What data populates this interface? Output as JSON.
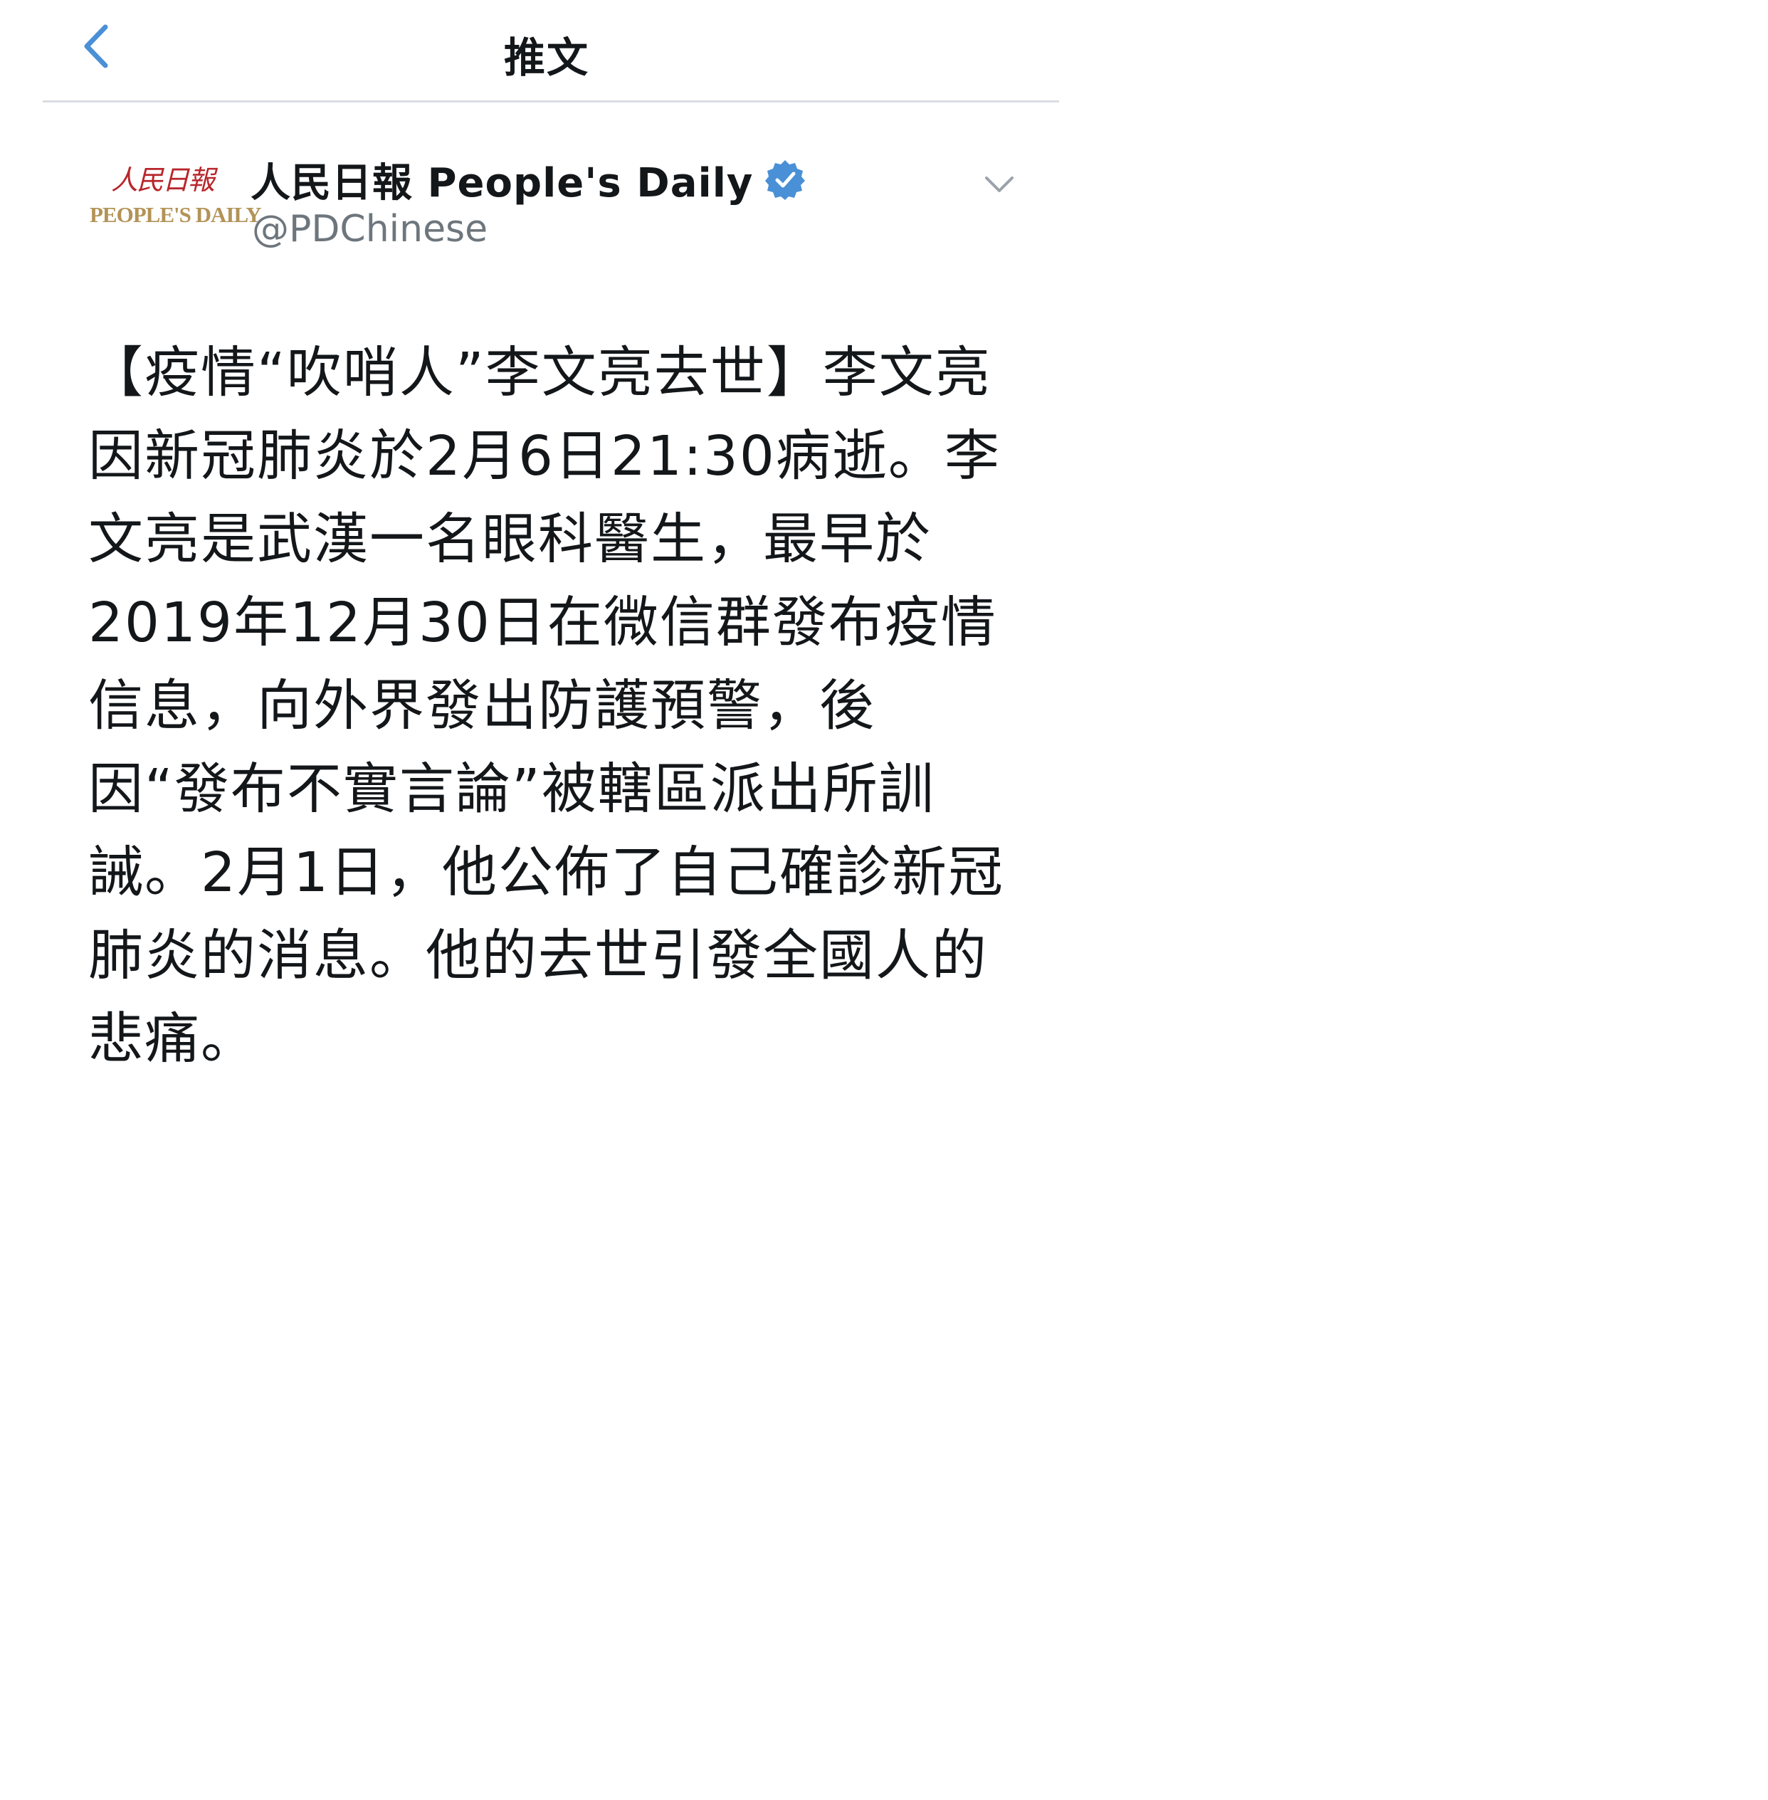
{
  "header": {
    "title": "推文",
    "back_icon": "chevron-left-icon"
  },
  "author": {
    "avatar_text_cn": "人民日報",
    "avatar_text_en": "PEOPLE'S DAILY",
    "display_name": "人民日報  People's Daily",
    "handle": "@PDChinese",
    "verified": true,
    "verified_icon": "verified-badge-icon",
    "menu_icon": "chevron-down-icon"
  },
  "tweet": {
    "text": "【疫情“吹哨人”李文亮去世】李文亮因新冠肺炎於2月6日21:30病逝。李文亮是武漢一名眼科醫生，最早於2019年12月30日在微信群發布疫情信息，向外界發出防護預警，後因“發布不實言論”被轄區派出所訓誡。2月1日，他公佈了自己確診新冠肺炎的消息。他的去世引發全國人的悲痛。"
  },
  "colors": {
    "accent": "#4a90d6",
    "text": "#14171a",
    "secondary": "#6e767d",
    "logo_red": "#b8262b",
    "logo_gold": "#b39357"
  }
}
